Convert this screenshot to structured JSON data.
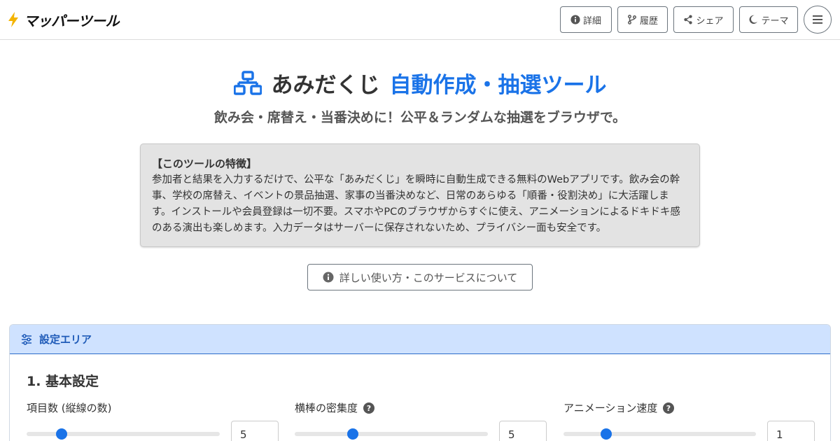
{
  "header": {
    "logo_text": "マッパーツール",
    "buttons": {
      "details": "詳細",
      "history": "履歴",
      "share": "シェア",
      "theme": "テーマ"
    }
  },
  "hero": {
    "title_part1": "あみだくじ",
    "title_part2": "自動作成・抽選ツール",
    "subtitle": "飲み会・席替え・当番決めに！公平＆ランダムな抽選をブラウザで。"
  },
  "feature": {
    "title": "【このツールの特徴】",
    "body": "参加者と結果を入力するだけで、公平な「あみだくじ」を瞬時に自動生成できる無料のWebアプリです。飲み会の幹事、学校の席替え、イベントの景品抽選、家事の当番決めなど、日常のあらゆる「順番・役割決め」に大活躍します。インストールや会員登録は一切不要。スマホやPCのブラウザからすぐに使え、アニメーションによるドキドキ感のある演出も楽しめます。入力データはサーバーに保存されないため、プライバシー面も安全です。"
  },
  "detail_button": "詳しい使い方・このサービスについて",
  "settings": {
    "header": "設定エリア",
    "section_title": "1. 基本設定",
    "fields": [
      {
        "label": "項目数 (縦線の数)",
        "value": "5",
        "slider_fraction": 0.18,
        "has_help": false
      },
      {
        "label": "横棒の密集度",
        "value": "5",
        "slider_fraction": 0.3,
        "has_help": true
      },
      {
        "label": "アニメーション速度",
        "value": "1",
        "slider_fraction": 0.22,
        "has_help": true
      }
    ]
  },
  "colors": {
    "accent": "#1a73e8",
    "settings_header_bg": "#cfe2ff",
    "feature_bg": "#e3e3e3"
  }
}
